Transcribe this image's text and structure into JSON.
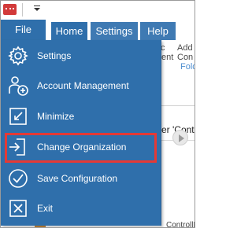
{
  "ribbon": {
    "tabs": [
      {
        "label": "File"
      },
      {
        "label": "Home"
      },
      {
        "label": "Settings"
      },
      {
        "label": "Help"
      }
    ],
    "partial_labels": {
      "c": "c",
      "add": "Add",
      "ent": "ent",
      "con": "Con",
      "folder": "Folde"
    }
  },
  "content": {
    "cell_text": "er 'Cont",
    "footer_text": "ControllM"
  },
  "file_menu": {
    "items": [
      {
        "label": "Settings",
        "icon": "gear-icon"
      },
      {
        "label": "Account Management",
        "icon": "account-add-icon"
      },
      {
        "label": "Minimize",
        "icon": "minimize-icon"
      },
      {
        "label": "Change Organization",
        "icon": "change-organization-icon"
      },
      {
        "label": "Save Configuration",
        "icon": "check-circle-icon"
      },
      {
        "label": "Exit",
        "icon": "exit-icon"
      }
    ]
  },
  "colors": {
    "menu_bg": "#2f6fab",
    "tab_bg": "#3f7ab3",
    "highlight": "#e53935"
  }
}
